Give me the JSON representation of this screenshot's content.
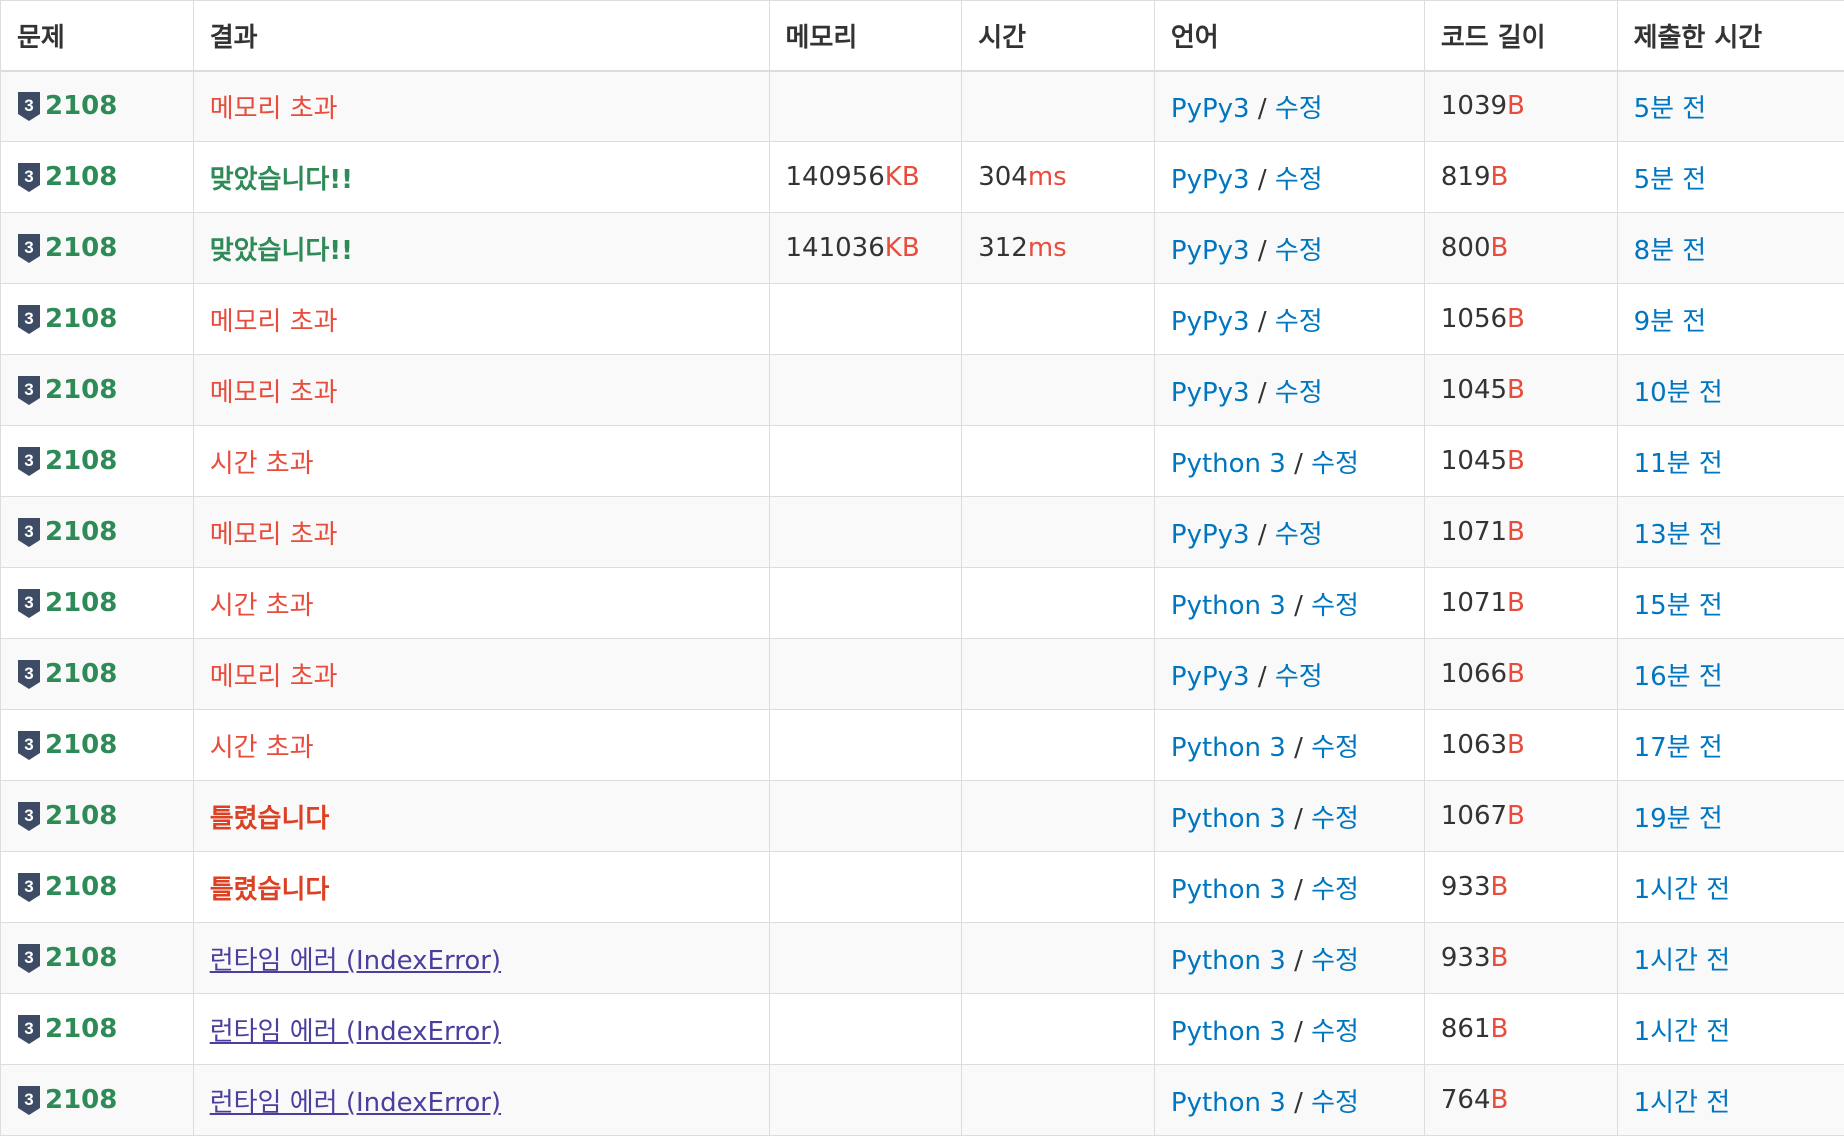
{
  "table": {
    "headers": {
      "problem": "문제",
      "result": "결과",
      "memory": "메모리",
      "time": "시간",
      "language": "언어",
      "code_length": "코드 길이",
      "submitted_at": "제출한 시간"
    },
    "tier_badge_label": "3",
    "separator": " / ",
    "units": {
      "memory": "KB",
      "time": "ms",
      "length": "B"
    },
    "rows": [
      {
        "problem": "2108",
        "result": "메모리 초과",
        "result_type": "memory",
        "memory": "",
        "time": "",
        "language": "PyPy3",
        "edit": "수정",
        "code_length": "1039",
        "submitted_at": "5분 전"
      },
      {
        "problem": "2108",
        "result": "맞았습니다!!",
        "result_type": "ac",
        "memory": "140956",
        "time": "304",
        "language": "PyPy3",
        "edit": "수정",
        "code_length": "819",
        "submitted_at": "5분 전"
      },
      {
        "problem": "2108",
        "result": "맞았습니다!!",
        "result_type": "ac",
        "memory": "141036",
        "time": "312",
        "language": "PyPy3",
        "edit": "수정",
        "code_length": "800",
        "submitted_at": "8분 전"
      },
      {
        "problem": "2108",
        "result": "메모리 초과",
        "result_type": "memory",
        "memory": "",
        "time": "",
        "language": "PyPy3",
        "edit": "수정",
        "code_length": "1056",
        "submitted_at": "9분 전"
      },
      {
        "problem": "2108",
        "result": "메모리 초과",
        "result_type": "memory",
        "memory": "",
        "time": "",
        "language": "PyPy3",
        "edit": "수정",
        "code_length": "1045",
        "submitted_at": "10분 전"
      },
      {
        "problem": "2108",
        "result": "시간 초과",
        "result_type": "time",
        "memory": "",
        "time": "",
        "language": "Python 3",
        "edit": "수정",
        "code_length": "1045",
        "submitted_at": "11분 전"
      },
      {
        "problem": "2108",
        "result": "메모리 초과",
        "result_type": "memory",
        "memory": "",
        "time": "",
        "language": "PyPy3",
        "edit": "수정",
        "code_length": "1071",
        "submitted_at": "13분 전"
      },
      {
        "problem": "2108",
        "result": "시간 초과",
        "result_type": "time",
        "memory": "",
        "time": "",
        "language": "Python 3",
        "edit": "수정",
        "code_length": "1071",
        "submitted_at": "15분 전"
      },
      {
        "problem": "2108",
        "result": "메모리 초과",
        "result_type": "memory",
        "memory": "",
        "time": "",
        "language": "PyPy3",
        "edit": "수정",
        "code_length": "1066",
        "submitted_at": "16분 전"
      },
      {
        "problem": "2108",
        "result": "시간 초과",
        "result_type": "time",
        "memory": "",
        "time": "",
        "language": "Python 3",
        "edit": "수정",
        "code_length": "1063",
        "submitted_at": "17분 전"
      },
      {
        "problem": "2108",
        "result": "틀렸습니다",
        "result_type": "wa",
        "memory": "",
        "time": "",
        "language": "Python 3",
        "edit": "수정",
        "code_length": "1067",
        "submitted_at": "19분 전"
      },
      {
        "problem": "2108",
        "result": "틀렸습니다",
        "result_type": "wa",
        "memory": "",
        "time": "",
        "language": "Python 3",
        "edit": "수정",
        "code_length": "933",
        "submitted_at": "1시간 전"
      },
      {
        "problem": "2108",
        "result": "런타임 에러 (IndexError)",
        "result_type": "rte",
        "memory": "",
        "time": "",
        "language": "Python 3",
        "edit": "수정",
        "code_length": "933",
        "submitted_at": "1시간 전"
      },
      {
        "problem": "2108",
        "result": "런타임 에러 (IndexError)",
        "result_type": "rte",
        "memory": "",
        "time": "",
        "language": "Python 3",
        "edit": "수정",
        "code_length": "861",
        "submitted_at": "1시간 전"
      },
      {
        "problem": "2108",
        "result": "런타임 에러 (IndexError)",
        "result_type": "rte",
        "memory": "",
        "time": "",
        "language": "Python 3",
        "edit": "수정",
        "code_length": "764",
        "submitted_at": "1시간 전"
      }
    ]
  },
  "colors": {
    "problem_link": "#2e8b57",
    "accepted": "#2e8b57",
    "error_red": "#e74c3c",
    "wrong_answer": "#dd4124",
    "runtime_error": "#4b3f9e",
    "link_blue": "#0076c0",
    "tier_badge": "#3d4b64"
  }
}
